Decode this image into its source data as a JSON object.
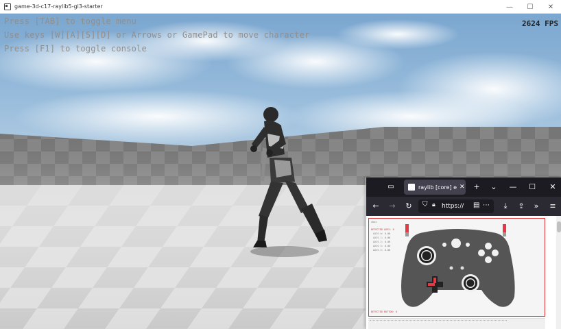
{
  "window": {
    "title": "game-3d-c17-raylib5-gl3-starter",
    "minimize_glyph": "—",
    "maximize_glyph": "☐",
    "close_glyph": "✕"
  },
  "game": {
    "instructions": [
      "Press [TAB] to toggle menu",
      "Use keys [W][A][S][D] or Arrows or GamePad to move character",
      "Press [F1] to toggle console"
    ],
    "fps": "2624 FPS"
  },
  "browser": {
    "tab_title": "raylib [core] example",
    "tab_close_glyph": "✕",
    "new_tab_glyph": "+",
    "list_all_tabs_glyph": "⌄",
    "url_display": "https://",
    "window_minimize_glyph": "—",
    "window_maximize_glyph": "☐",
    "window_close_glyph": "✕",
    "nav": {
      "back": "←",
      "forward": "→",
      "reload": "↻",
      "reader": "▤",
      "more": "⋯",
      "download": "⤓",
      "extensions": "⇪",
      "overflow": "»",
      "menu": "≡"
    },
    "example": {
      "title": "xbox",
      "detected": "DETECTED AXES: 6",
      "axes": [
        "AXIS 0: 0.00",
        "AXIS 1: 0.00",
        "AXIS 2: 0.00",
        "AXIS 3: 0.00",
        "AXIS 4: 0.00"
      ],
      "detected_button": "DETECTED BUTTON: 0"
    }
  },
  "colors": {
    "overlay_text": "#8f8f8f",
    "fps_text": "#222222",
    "browser_dark": "#1c1b22",
    "browser_tab": "#42414d",
    "gamepad_body": "#555555",
    "gamepad_accent": "#e63946"
  }
}
